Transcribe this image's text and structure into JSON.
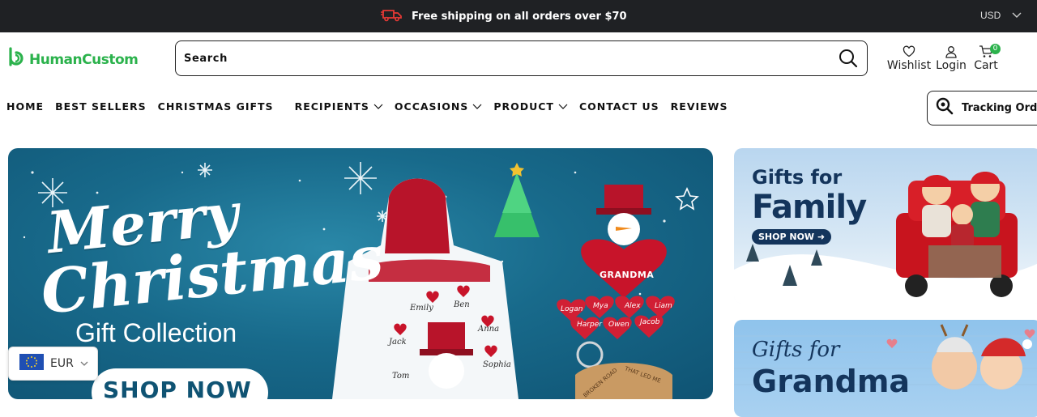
{
  "announcement": {
    "text": "Free shipping on all orders over $70",
    "icon": "shipping-truck-icon",
    "accent": "#e53935"
  },
  "currency_top": {
    "value": "USD"
  },
  "brand": {
    "name": "HumanCustom",
    "color": "#2bb24c"
  },
  "search": {
    "placeholder": "Search",
    "value": ""
  },
  "header_actions": {
    "wishlist": "Wishlist",
    "login": "Login",
    "cart": "Cart",
    "cart_count": "0"
  },
  "nav": {
    "items": [
      {
        "label": "HOME",
        "dropdown": false
      },
      {
        "label": "BEST SELLERS",
        "dropdown": false
      },
      {
        "label": "CHRISTMAS GIFTS",
        "dropdown": false
      },
      {
        "label": "RECIPIENTS",
        "dropdown": true
      },
      {
        "label": "OCCASIONS",
        "dropdown": true
      },
      {
        "label": "PRODUCT",
        "dropdown": true
      },
      {
        "label": "CONTACT US",
        "dropdown": false
      },
      {
        "label": "REVIEWS",
        "dropdown": false
      }
    ],
    "tracking": "Tracking Order"
  },
  "hero": {
    "line1": "Merry",
    "line2": "Christmas",
    "line3": "Gift Collection",
    "cta": "SHOP NOW",
    "hoodie_names": [
      "Emily",
      "Ben",
      "Anna",
      "Jack",
      "Tom",
      "Sophia"
    ],
    "ornament_title": "GRANDMA",
    "ornament_names": [
      "Logan",
      "Mya",
      "Alex",
      "Liam",
      "Harper",
      "Owen",
      "Jacob"
    ],
    "keychain_text": [
      "BROKEN ROAD",
      "THAT LED ME"
    ]
  },
  "side_banners": [
    {
      "line1": "Gifts for",
      "line2": "Family",
      "cta": "SHOP NOW"
    },
    {
      "line1": "Gifts for",
      "line2": "Grandma"
    }
  ],
  "currency_switcher": {
    "value": "EUR",
    "flag": "eu-flag-icon"
  }
}
